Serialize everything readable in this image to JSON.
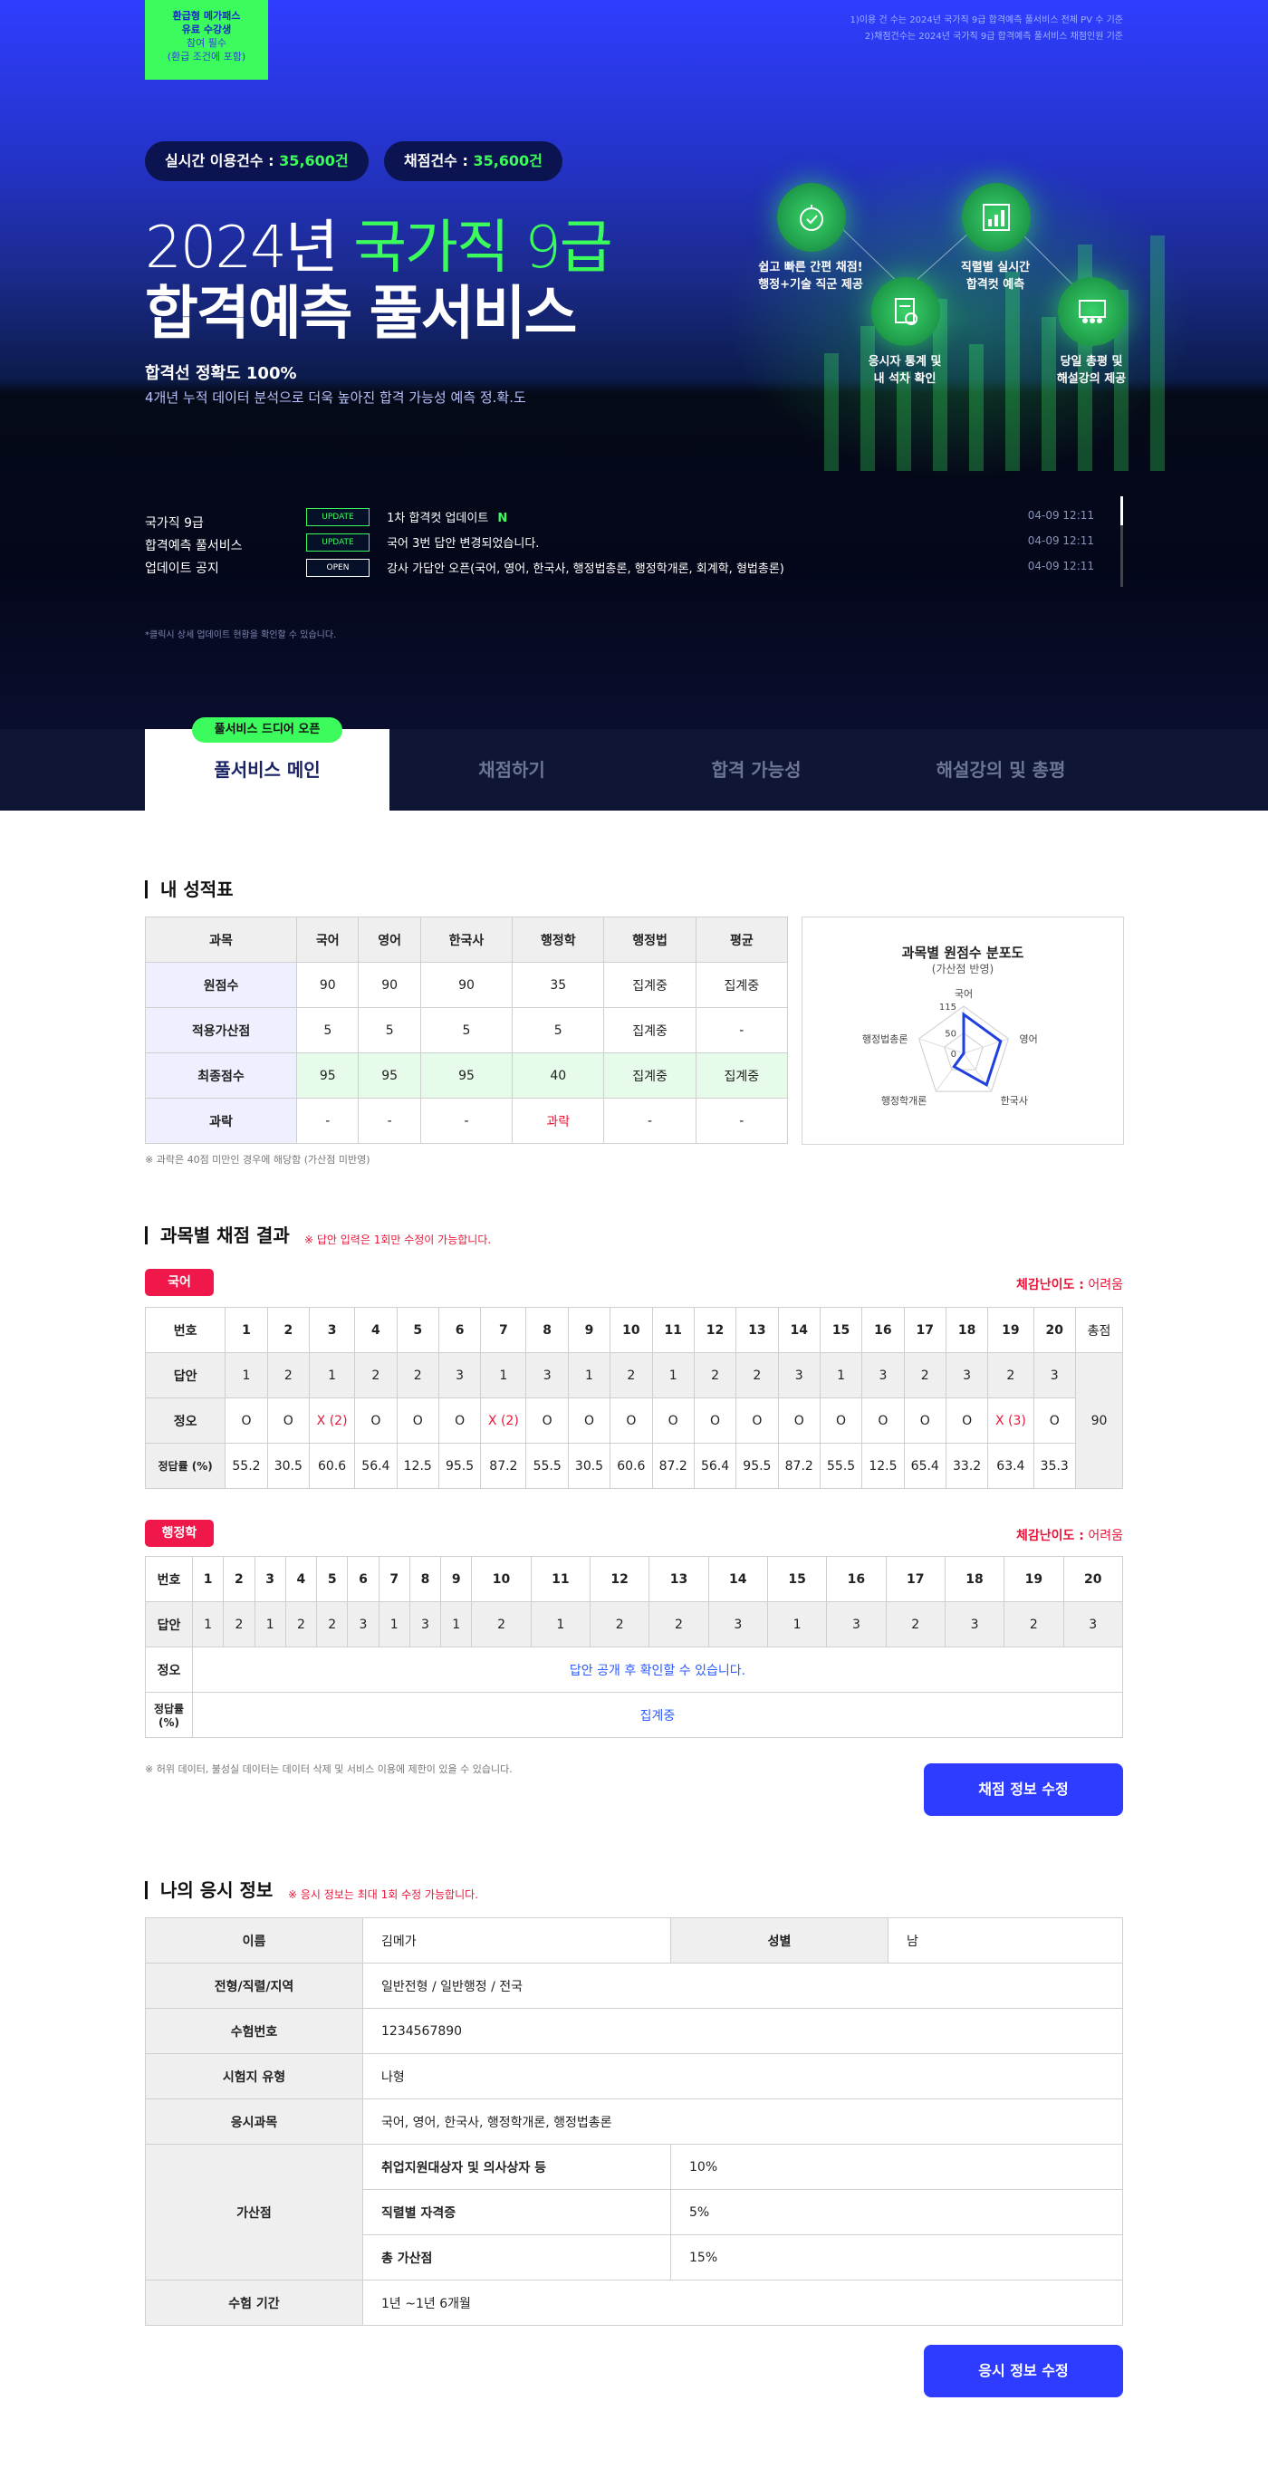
{
  "hero": {
    "badge": {
      "line1": "환급형 메가패스",
      "line2": "유료 수강생",
      "line3": "참여 필수",
      "line4": "(환급 조건에 포함)"
    },
    "topnote": {
      "line1": "1)이용 건 수는 2024년 국가직 9급 합격예측 풀서비스 전체 PV 수 기준",
      "line2": "2)채점건수는 2024년 국가직 9급 합격예측 풀서비스 채점인원 기준"
    },
    "realtime_label": "실시간 이용건수 :",
    "realtime_value": "35,600건",
    "scored_label": "채점건수 :",
    "scored_value": "35,600건",
    "title_year": "2024년",
    "title_exam": "국가직 9급",
    "title_main": "합격예측 풀서비스",
    "accuracy": "합격선 정확도 100%",
    "accuracy_sub": "4개년 누적 데이터 분석으로 더욱 높아진 합격 가능성 예측 정.확.도",
    "features": [
      {
        "line1": "쉽고 빠른 간편 채점!",
        "line2": "행정+기술 직군 제공",
        "icon": "stopwatch-icon"
      },
      {
        "line1": "응시자 통계 및",
        "line2": "내 석차 확인",
        "icon": "document-chart-icon"
      },
      {
        "line1": "직렬별 실시간",
        "line2": "합격컷 예측",
        "icon": "bar-chart-icon"
      },
      {
        "line1": "당일 총평 및",
        "line2": "해설강의 제공",
        "icon": "lecture-icon"
      }
    ]
  },
  "notice": {
    "title1": "국가직 9급",
    "title2": "합격예측 풀서비스",
    "title3": "업데이트 공지",
    "items": [
      {
        "tag": "UPDATE",
        "text": "1차 합격컷 업데이트",
        "new": "N",
        "date": "04-09 12:11"
      },
      {
        "tag": "UPDATE",
        "text": "국어 3번 답안 변경되었습니다.",
        "new": "",
        "date": "04-09 12:11"
      },
      {
        "tag": "OPEN",
        "text": "강사 가답안 오픈(국어, 영어, 한국사, 행정법총론, 행정학개론, 회계학, 형법총론)",
        "new": "",
        "date": "04-09 12:11"
      }
    ],
    "footnote": "*클릭시 상세 업데이트 현황을 확인할 수 있습니다."
  },
  "tabs": {
    "badge": "풀서비스 드디어 오픈",
    "items": [
      "풀서비스 메인",
      "채점하기",
      "합격 가능성",
      "해설강의 및 총평"
    ]
  },
  "report": {
    "title": "내 성적표",
    "headers": [
      "과목",
      "국어",
      "영어",
      "한국사",
      "행정학",
      "행정법",
      "평균"
    ],
    "rows": [
      [
        "원점수",
        "90",
        "90",
        "90",
        "35",
        "집계중",
        "집계중"
      ],
      [
        "적용가산점",
        "5",
        "5",
        "5",
        "5",
        "집계중",
        "-"
      ],
      [
        "최종점수",
        "95",
        "95",
        "95",
        "40",
        "집계중",
        "집계중"
      ],
      [
        "과락",
        "-",
        "-",
        "-",
        "과락",
        "-",
        "-"
      ]
    ],
    "note": "※ 과락은 40점 미만인 경우에 해당함 (가산점 미반영)",
    "radar": {
      "title": "과목별 원점수 분포도",
      "subtitle": "(가산점 반영)",
      "axes": [
        "국어",
        "영어",
        "한국사",
        "행정학개론",
        "행정법총론"
      ],
      "tick_outer": "115",
      "tick_mid": "50",
      "tick_zero": "0",
      "values": [
        95,
        95,
        95,
        40,
        0
      ],
      "max": 115,
      "color": "#1f3fe0"
    }
  },
  "results": {
    "title": "과목별 채점 결과",
    "note": "※ 답안 입력은 1회만 수정이 가능합니다.",
    "korean": {
      "subject": "국어",
      "difficulty_label": "체감난이도 :",
      "difficulty_value": "어려움",
      "row_labels": [
        "번호",
        "답안",
        "정오",
        "정답률 (%)"
      ],
      "total_label": "총점",
      "total_value": "90",
      "numbers": [
        "1",
        "2",
        "3",
        "4",
        "5",
        "6",
        "7",
        "8",
        "9",
        "10",
        "11",
        "12",
        "13",
        "14",
        "15",
        "16",
        "17",
        "18",
        "19",
        "20"
      ],
      "answers": [
        "1",
        "2",
        "1",
        "2",
        "2",
        "3",
        "1",
        "3",
        "1",
        "2",
        "1",
        "2",
        "2",
        "3",
        "1",
        "3",
        "2",
        "3",
        "2",
        "3"
      ],
      "marks": [
        "O",
        "O",
        "X (2)",
        "O",
        "O",
        "O",
        "X (2)",
        "O",
        "O",
        "O",
        "O",
        "O",
        "O",
        "O",
        "O",
        "O",
        "O",
        "O",
        "X (3)",
        "O"
      ],
      "rates": [
        "55.2",
        "30.5",
        "60.6",
        "56.4",
        "12.5",
        "95.5",
        "87.2",
        "55.5",
        "30.5",
        "60.6",
        "87.2",
        "56.4",
        "95.5",
        "87.2",
        "55.5",
        "12.5",
        "65.4",
        "33.2",
        "63.4",
        "35.3"
      ]
    },
    "admin": {
      "subject": "행정학",
      "difficulty_label": "체감난이도 :",
      "difficulty_value": "어려움",
      "row_labels": [
        "번호",
        "답안",
        "정오",
        "정답률 (%)"
      ],
      "numbers": [
        "1",
        "2",
        "3",
        "4",
        "5",
        "6",
        "7",
        "8",
        "9",
        "10",
        "11",
        "12",
        "13",
        "14",
        "15",
        "16",
        "17",
        "18",
        "19",
        "20"
      ],
      "answers": [
        "1",
        "2",
        "1",
        "2",
        "2",
        "3",
        "1",
        "3",
        "1",
        "2",
        "1",
        "2",
        "2",
        "3",
        "1",
        "3",
        "2",
        "3",
        "2",
        "3"
      ],
      "pending_marks": "답안 공개 후 확인할 수 있습니다.",
      "pending_rates": "집계중"
    },
    "footnote": "※ 허위 데이터, 불성실 데이터는 데이터 삭제 및 서비스 이용에 제한이 있을 수 있습니다.",
    "edit_button": "채점 정보 수정"
  },
  "info": {
    "title": "나의 응시 정보",
    "note": "※ 응시 정보는 최대 1회 수정 가능합니다.",
    "name_label": "이름",
    "name_value": "김메가",
    "gender_label": "성별",
    "gender_value": "남",
    "type_label": "전형/직렬/지역",
    "type_value": "일반전형 / 일반행정 / 전국",
    "id_label": "수험번호",
    "id_value": "1234567890",
    "paper_label": "시험지 유형",
    "paper_value": "나형",
    "subjects_label": "응시과목",
    "subjects_value": "국어, 영어, 한국사, 행정학개론, 행정법총론",
    "bonus_label": "가산점",
    "bonus_rows": [
      {
        "label": "취업지원대상자 및 의사상자 등",
        "value": "10%"
      },
      {
        "label": "직렬별 자격증",
        "value": "5%"
      },
      {
        "label": "총 가산점",
        "value": "15%"
      }
    ],
    "period_label": "수험 기간",
    "period_value": "1년 ~1년 6개월",
    "edit_button": "응시 정보 수정"
  }
}
